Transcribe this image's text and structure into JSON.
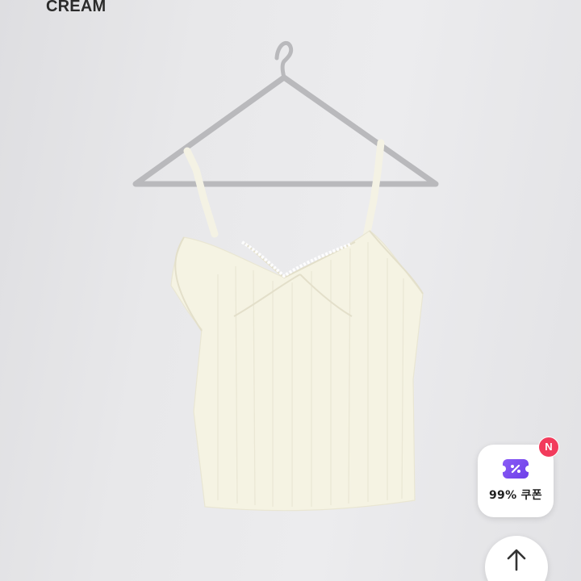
{
  "product": {
    "color_label": "CREAM"
  },
  "coupon": {
    "label": "99% 쿠폰",
    "icon": "coupon-ticket-icon",
    "badge": "N",
    "accent": "#7b4ff0",
    "badge_color": "#f23b5c"
  },
  "scroll_top": {
    "icon": "arrow-up-icon"
  }
}
